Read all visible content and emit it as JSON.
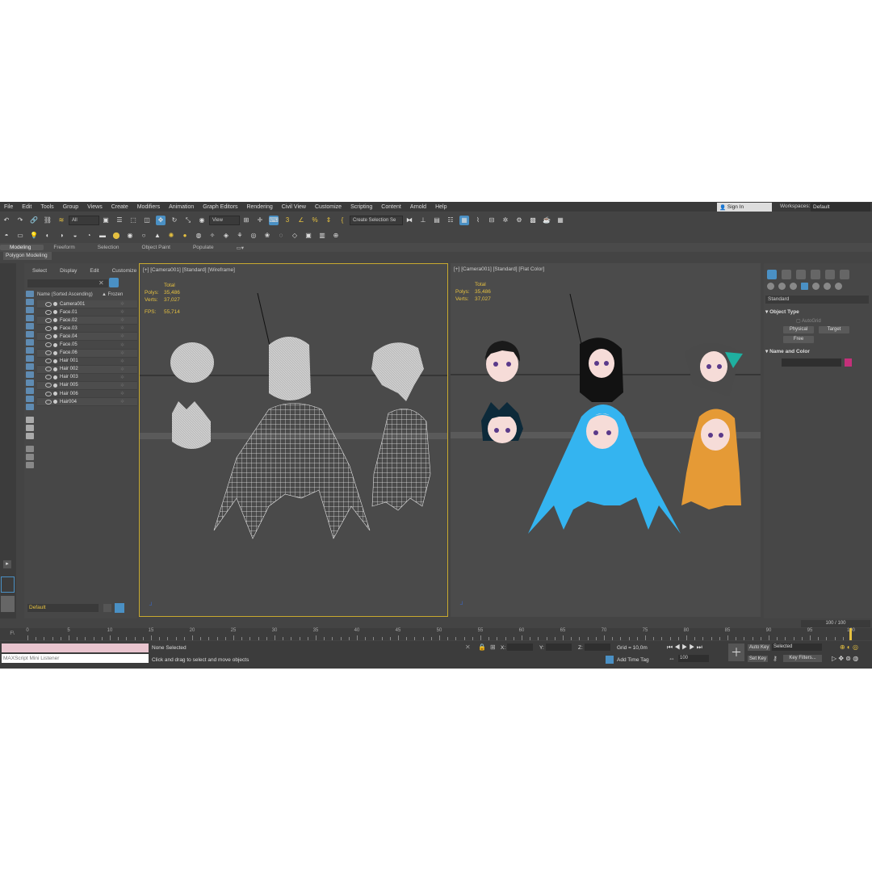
{
  "menu": [
    "File",
    "Edit",
    "Tools",
    "Group",
    "Views",
    "Create",
    "Modifiers",
    "Animation",
    "Graph Editors",
    "Rendering",
    "Civil View",
    "Customize",
    "Scripting",
    "Content",
    "Arnold",
    "Help"
  ],
  "signin": "Sign In",
  "workspaces_label": "Workspaces:",
  "workspaces_value": "Default",
  "toolbar": {
    "filter_all": "All",
    "view_dd": "View",
    "selection_set": "Create Selection Se"
  },
  "ribbon_tabs": [
    "Modeling",
    "Freeform",
    "Selection",
    "Object Paint",
    "Populate"
  ],
  "ribbon_active": "Polygon Modeling",
  "explorer": {
    "menu": [
      "Select",
      "Display",
      "Edit",
      "Customize"
    ],
    "col_name": "Name (Sorted Ascending)",
    "col_frozen": "▲ Frozen",
    "rows": [
      "Camera001",
      "Face.01",
      "Face.02",
      "Face.03",
      "Face.04",
      "Face.05",
      "Face.06",
      "Hair 001",
      "Hair 002",
      "Hair 003",
      "Hair 005",
      "Hair 006",
      "Hair004"
    ],
    "layer": "Default"
  },
  "viewport_left": {
    "label": "[+] [Camera001] [Standard] [Wireframe]",
    "total": "Total",
    "polys_label": "Polys:",
    "polys": "35,486",
    "verts_label": "Verts:",
    "verts": "37,027",
    "fps_label": "FPS:",
    "fps": "55,714"
  },
  "viewport_right": {
    "label": "[+] [Camera001] [Standard] [Flat Color]",
    "total": "Total",
    "polys_label": "Polys:",
    "polys": "35,486",
    "verts_label": "Verts:",
    "verts": "37,027"
  },
  "command_panel": {
    "dropdown": "Standard",
    "object_type": "Object Type",
    "autogrid": "AutoGrid",
    "physical": "Physical",
    "target": "Target",
    "free": "Free",
    "name_color": "Name and Color",
    "swatch_color": "#c4307a"
  },
  "timeline": {
    "counter": "100 / 100",
    "ticks": [
      "0",
      "5",
      "10",
      "15",
      "20",
      "25",
      "30",
      "35",
      "40",
      "45",
      "50",
      "55",
      "60",
      "65",
      "70",
      "75",
      "80",
      "85",
      "90",
      "95",
      "100"
    ]
  },
  "status": {
    "maxscript": "MAXScript Mini Listener",
    "none_selected": "None Selected",
    "hint": "Click and drag to select and move objects",
    "x_label": "X:",
    "y_label": "Y:",
    "z_label": "Z:",
    "grid": "Grid = 10,0m",
    "add_time_tag": "Add Time Tag",
    "auto_key": "Auto Key",
    "selected": "Selected",
    "set_key": "Set Key",
    "key_filters": "Key Filters...",
    "frame": "100"
  },
  "colors": {
    "accent": "#4a90c4",
    "active_border": "#c8a92f",
    "stats": "#e5c040"
  }
}
